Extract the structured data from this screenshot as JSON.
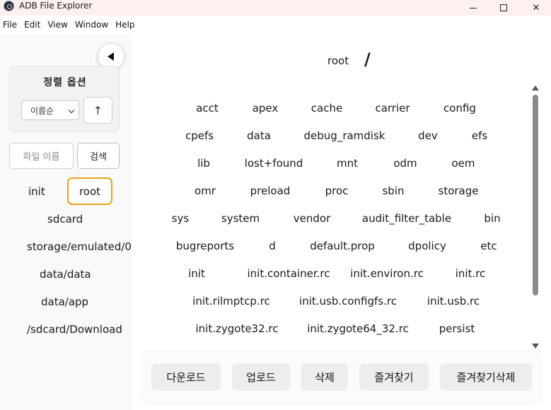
{
  "window": {
    "title": "ADB File Explorer"
  },
  "menu": [
    "File",
    "Edit",
    "View",
    "Window",
    "Help"
  ],
  "sidebar": {
    "sort_title": "정렬 옵션",
    "sort_select_value": "이름순",
    "sort_direction": "↑",
    "filename_placeholder": "파일 이름",
    "search_label": "검색",
    "favorites": [
      "init",
      "root",
      "sdcard",
      "storage/emulated/0",
      "data/data",
      "data/app",
      "/sdcard/Download"
    ]
  },
  "main": {
    "path_root": "root",
    "path_separator": "/",
    "files": [
      "acct",
      "apex",
      "cache",
      "carrier",
      "config",
      "cpefs",
      "data",
      "debug_ramdisk",
      "dev",
      "efs",
      "lib",
      "lost+found",
      "mnt",
      "odm",
      "oem",
      "omr",
      "preload",
      "proc",
      "sbin",
      "storage",
      "sys",
      "system",
      "vendor",
      "audit_filter_table",
      "bin",
      "bugreports",
      "d",
      "default.prop",
      "dpolicy",
      "etc",
      "init",
      "init.container.rc",
      "init.environ.rc",
      "init.rc",
      "init.rilmptcp.rc",
      "init.usb.configfs.rc",
      "init.usb.rc",
      "init.zygote32.rc",
      "init.zygote64_32.rc",
      "persist"
    ]
  },
  "actions": [
    "다운로드",
    "업로드",
    "삭제",
    "즐겨찾기",
    "즐겨찾기삭제"
  ],
  "colors": {
    "selected_border": "#e3a21a",
    "titlebar_bg": "#fdf0f0",
    "button_bg": "#ededed"
  }
}
